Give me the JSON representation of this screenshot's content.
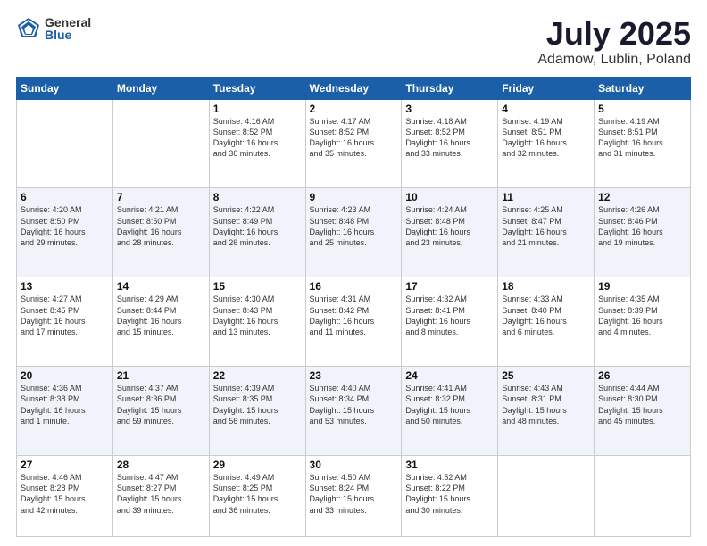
{
  "logo": {
    "general": "General",
    "blue": "Blue"
  },
  "title": "July 2025",
  "subtitle": "Adamow, Lublin, Poland",
  "days_of_week": [
    "Sunday",
    "Monday",
    "Tuesday",
    "Wednesday",
    "Thursday",
    "Friday",
    "Saturday"
  ],
  "weeks": [
    [
      {
        "day": "",
        "info": ""
      },
      {
        "day": "",
        "info": ""
      },
      {
        "day": "1",
        "info": "Sunrise: 4:16 AM\nSunset: 8:52 PM\nDaylight: 16 hours\nand 36 minutes."
      },
      {
        "day": "2",
        "info": "Sunrise: 4:17 AM\nSunset: 8:52 PM\nDaylight: 16 hours\nand 35 minutes."
      },
      {
        "day": "3",
        "info": "Sunrise: 4:18 AM\nSunset: 8:52 PM\nDaylight: 16 hours\nand 33 minutes."
      },
      {
        "day": "4",
        "info": "Sunrise: 4:19 AM\nSunset: 8:51 PM\nDaylight: 16 hours\nand 32 minutes."
      },
      {
        "day": "5",
        "info": "Sunrise: 4:19 AM\nSunset: 8:51 PM\nDaylight: 16 hours\nand 31 minutes."
      }
    ],
    [
      {
        "day": "6",
        "info": "Sunrise: 4:20 AM\nSunset: 8:50 PM\nDaylight: 16 hours\nand 29 minutes."
      },
      {
        "day": "7",
        "info": "Sunrise: 4:21 AM\nSunset: 8:50 PM\nDaylight: 16 hours\nand 28 minutes."
      },
      {
        "day": "8",
        "info": "Sunrise: 4:22 AM\nSunset: 8:49 PM\nDaylight: 16 hours\nand 26 minutes."
      },
      {
        "day": "9",
        "info": "Sunrise: 4:23 AM\nSunset: 8:48 PM\nDaylight: 16 hours\nand 25 minutes."
      },
      {
        "day": "10",
        "info": "Sunrise: 4:24 AM\nSunset: 8:48 PM\nDaylight: 16 hours\nand 23 minutes."
      },
      {
        "day": "11",
        "info": "Sunrise: 4:25 AM\nSunset: 8:47 PM\nDaylight: 16 hours\nand 21 minutes."
      },
      {
        "day": "12",
        "info": "Sunrise: 4:26 AM\nSunset: 8:46 PM\nDaylight: 16 hours\nand 19 minutes."
      }
    ],
    [
      {
        "day": "13",
        "info": "Sunrise: 4:27 AM\nSunset: 8:45 PM\nDaylight: 16 hours\nand 17 minutes."
      },
      {
        "day": "14",
        "info": "Sunrise: 4:29 AM\nSunset: 8:44 PM\nDaylight: 16 hours\nand 15 minutes."
      },
      {
        "day": "15",
        "info": "Sunrise: 4:30 AM\nSunset: 8:43 PM\nDaylight: 16 hours\nand 13 minutes."
      },
      {
        "day": "16",
        "info": "Sunrise: 4:31 AM\nSunset: 8:42 PM\nDaylight: 16 hours\nand 11 minutes."
      },
      {
        "day": "17",
        "info": "Sunrise: 4:32 AM\nSunset: 8:41 PM\nDaylight: 16 hours\nand 8 minutes."
      },
      {
        "day": "18",
        "info": "Sunrise: 4:33 AM\nSunset: 8:40 PM\nDaylight: 16 hours\nand 6 minutes."
      },
      {
        "day": "19",
        "info": "Sunrise: 4:35 AM\nSunset: 8:39 PM\nDaylight: 16 hours\nand 4 minutes."
      }
    ],
    [
      {
        "day": "20",
        "info": "Sunrise: 4:36 AM\nSunset: 8:38 PM\nDaylight: 16 hours\nand 1 minute."
      },
      {
        "day": "21",
        "info": "Sunrise: 4:37 AM\nSunset: 8:36 PM\nDaylight: 15 hours\nand 59 minutes."
      },
      {
        "day": "22",
        "info": "Sunrise: 4:39 AM\nSunset: 8:35 PM\nDaylight: 15 hours\nand 56 minutes."
      },
      {
        "day": "23",
        "info": "Sunrise: 4:40 AM\nSunset: 8:34 PM\nDaylight: 15 hours\nand 53 minutes."
      },
      {
        "day": "24",
        "info": "Sunrise: 4:41 AM\nSunset: 8:32 PM\nDaylight: 15 hours\nand 50 minutes."
      },
      {
        "day": "25",
        "info": "Sunrise: 4:43 AM\nSunset: 8:31 PM\nDaylight: 15 hours\nand 48 minutes."
      },
      {
        "day": "26",
        "info": "Sunrise: 4:44 AM\nSunset: 8:30 PM\nDaylight: 15 hours\nand 45 minutes."
      }
    ],
    [
      {
        "day": "27",
        "info": "Sunrise: 4:46 AM\nSunset: 8:28 PM\nDaylight: 15 hours\nand 42 minutes."
      },
      {
        "day": "28",
        "info": "Sunrise: 4:47 AM\nSunset: 8:27 PM\nDaylight: 15 hours\nand 39 minutes."
      },
      {
        "day": "29",
        "info": "Sunrise: 4:49 AM\nSunset: 8:25 PM\nDaylight: 15 hours\nand 36 minutes."
      },
      {
        "day": "30",
        "info": "Sunrise: 4:50 AM\nSunset: 8:24 PM\nDaylight: 15 hours\nand 33 minutes."
      },
      {
        "day": "31",
        "info": "Sunrise: 4:52 AM\nSunset: 8:22 PM\nDaylight: 15 hours\nand 30 minutes."
      },
      {
        "day": "",
        "info": ""
      },
      {
        "day": "",
        "info": ""
      }
    ]
  ]
}
